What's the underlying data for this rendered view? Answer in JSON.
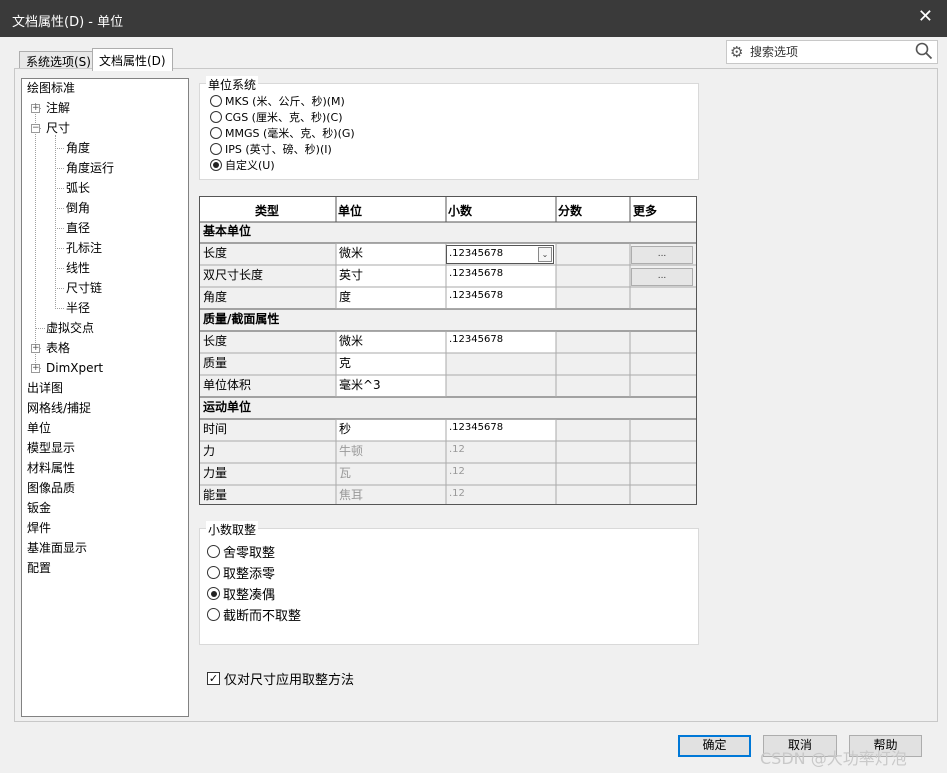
{
  "window": {
    "title": "文档属性(D) - 单位",
    "close_label": "✕"
  },
  "tabs": [
    {
      "label": "系统选项(S)",
      "active": false
    },
    {
      "label": "文档属性(D)",
      "active": true
    }
  ],
  "search": {
    "placeholder": "搜索选项"
  },
  "tree": {
    "items": [
      {
        "label": "绘图标准"
      },
      {
        "label": "注解"
      },
      {
        "label": "尺寸"
      },
      {
        "label": "角度"
      },
      {
        "label": "角度运行"
      },
      {
        "label": "弧长"
      },
      {
        "label": "倒角"
      },
      {
        "label": "直径"
      },
      {
        "label": "孔标注"
      },
      {
        "label": "线性"
      },
      {
        "label": "尺寸链"
      },
      {
        "label": "半径"
      },
      {
        "label": "虚拟交点"
      },
      {
        "label": "表格"
      },
      {
        "label": "DimXpert"
      },
      {
        "label": "出详图"
      },
      {
        "label": "网格线/捕捉"
      },
      {
        "label": "单位",
        "selected": true
      },
      {
        "label": "模型显示"
      },
      {
        "label": "材料属性"
      },
      {
        "label": "图像品质"
      },
      {
        "label": "钣金"
      },
      {
        "label": "焊件"
      },
      {
        "label": "基准面显示"
      },
      {
        "label": "配置"
      }
    ],
    "expand_plus": "+",
    "expand_minus": "−"
  },
  "unit_system": {
    "title": "单位系统",
    "options": [
      {
        "label": "MKS (米、公斤、秒)(M)",
        "checked": false
      },
      {
        "label": "CGS (厘米、克、秒)(C)",
        "checked": false
      },
      {
        "label": "MMGS (毫米、克、秒)(G)",
        "checked": false
      },
      {
        "label": "IPS (英寸、磅、秒)(I)",
        "checked": false
      },
      {
        "label": "自定义(U)",
        "checked": true
      }
    ]
  },
  "unit_table": {
    "headers": {
      "type": "类型",
      "unit": "单位",
      "decimals": "小数",
      "fractions": "分数",
      "more": "更多"
    },
    "sections": [
      {
        "title": "基本单位"
      },
      {
        "title": "质量/截面属性"
      },
      {
        "title": "运动单位"
      }
    ],
    "rows": [
      {
        "type": "长度",
        "unit": "微米",
        "decimals": ".12345678",
        "more_label": "..."
      },
      {
        "type": "双尺寸长度",
        "unit": "英寸",
        "decimals": ".12345678",
        "more_label": "..."
      },
      {
        "type": "角度",
        "unit": "度",
        "decimals": ".12345678"
      },
      {
        "type": "长度",
        "unit": "微米",
        "decimals": ".12345678"
      },
      {
        "type": "质量",
        "unit": "克",
        "decimals": ""
      },
      {
        "type": "单位体积",
        "unit": "毫米^3",
        "decimals": ""
      },
      {
        "type": "时间",
        "unit": "秒",
        "decimals": ".12345678"
      },
      {
        "type": "力",
        "unit": "牛顿",
        "decimals": ".12"
      },
      {
        "type": "力量",
        "unit": "瓦",
        "decimals": ".12"
      },
      {
        "type": "能量",
        "unit": "焦耳",
        "decimals": ".12"
      }
    ],
    "combo_arrow": "⌄"
  },
  "rounding": {
    "title": "小数取整",
    "options": [
      {
        "label": "舍零取整",
        "checked": false
      },
      {
        "label": "取整添零",
        "checked": false
      },
      {
        "label": "取整凑偶",
        "checked": true
      },
      {
        "label": "截断而不取整",
        "checked": false
      }
    ]
  },
  "apply_rounding_only_dimensions": {
    "label": "仅对尺寸应用取整方法",
    "checked": true,
    "mark": "✓"
  },
  "buttons": {
    "ok": "确定",
    "cancel": "取消",
    "help": "帮助"
  },
  "watermark": "CSDN @大功率灯泡",
  "icons": {
    "gear": "⚙",
    "search": "🔍"
  }
}
